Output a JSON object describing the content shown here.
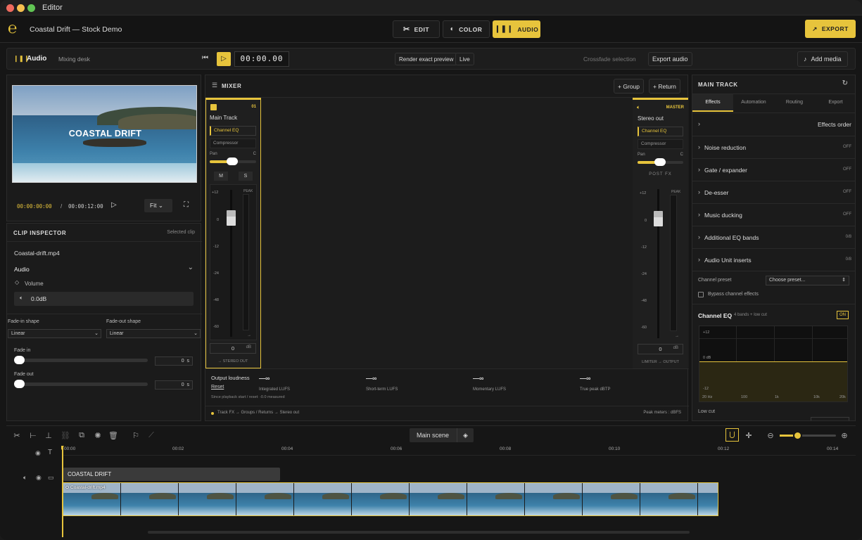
{
  "window": {
    "title": "Editor"
  },
  "app": {
    "project_title": "Coastal Drift — Stock Demo",
    "logo_icon": "e-logo-icon",
    "accent_color": "#e7c43c"
  },
  "modes": [
    {
      "label": "EDIT",
      "icon": "scissors-icon"
    },
    {
      "label": "COLOR",
      "icon": "palette-icon"
    },
    {
      "label": "AUDIO",
      "icon": "waveform-icon",
      "active": true
    }
  ],
  "export_button": "EXPORT",
  "toolbar": {
    "section": "Audio",
    "subsection": "Mixing desk",
    "timecode": "00:00.00",
    "render_preview": "Render exact preview",
    "live": "Live",
    "crossfade": "Crossfade selection",
    "export_audio": "Export audio",
    "add_media": "Add media"
  },
  "preview": {
    "overlay_title": "COASTAL DRIFT",
    "current_time": "00:00:00:00",
    "separator": "/",
    "duration": "00:00:12:00",
    "fit": "Fit"
  },
  "inspector": {
    "header": "CLIP INSPECTOR",
    "scope": "Selected clip",
    "filename": "Coastal-drift.mp4",
    "section": "Audio",
    "volume_label": "Volume",
    "volume_value": "0.0dB",
    "fade_in_shape_label": "Fade-in shape",
    "fade_in_shape": "Linear",
    "fade_out_shape_label": "Fade-out shape",
    "fade_out_shape": "Linear",
    "fade_in_label": "Fade in",
    "fade_in_value": "0",
    "fade_in_unit": "s",
    "fade_out_label": "Fade out",
    "fade_out_value": "0",
    "fade_out_unit": "s"
  },
  "mixer": {
    "header": "MIXER",
    "group_button": "+ Group",
    "return_button": "+ Return",
    "channels": [
      {
        "name": "Main Track",
        "tag": "01",
        "fx1": "Channel EQ",
        "fx2": "Compressor",
        "pan": "Pan",
        "pan_c": "C",
        "m": "M",
        "s": "S",
        "peak": "PEAK",
        "scale": [
          "+12",
          "0",
          "-12",
          "-24",
          "-48",
          "-60"
        ],
        "fader_value": "0",
        "fader_unit": "dB",
        "arrow": "→",
        "route": "→ STEREO OUT",
        "fader_level_db": 0
      },
      {
        "name": "Stereo out",
        "tag": "MASTER",
        "fx1": "Channel EQ",
        "fx2": "Compressor",
        "pan": "Pan",
        "pan_c": "C",
        "post_fx": "POST FX",
        "peak": "PEAK",
        "scale": [
          "+12",
          "0",
          "-12",
          "-24",
          "-48",
          "-60"
        ],
        "fader_value": "0",
        "fader_unit": "dB",
        "arrow": "→",
        "route": "LIMITER → OUTPUT",
        "fader_level_db": 0
      }
    ],
    "loudness": {
      "title": "Output loudness",
      "reset": "Reset",
      "note": "Since playback start / reset: -0.0 measured",
      "meters": [
        {
          "value": "—∞",
          "label": "Integrated LUFS"
        },
        {
          "value": "—∞",
          "label": "Short-term LUFS"
        },
        {
          "value": "—∞",
          "label": "Momentary LUFS"
        },
        {
          "value": "—∞",
          "label": "True peak dBTP"
        }
      ]
    },
    "footer_left": "Track FX → Groups / Returns → Stereo out",
    "footer_right": "Peak meters : dBFS"
  },
  "main_track": {
    "header": "MAIN TRACK",
    "tabs": [
      "Effects",
      "Automation",
      "Routing",
      "Export"
    ],
    "effects_order": "Effects order",
    "effects": [
      {
        "name": "Noise reduction",
        "status": "OFF"
      },
      {
        "name": "Gate / expander",
        "status": "OFF"
      },
      {
        "name": "De-esser",
        "status": "OFF"
      },
      {
        "name": "Music ducking",
        "status": "OFF"
      },
      {
        "name": "Additional EQ bands",
        "status": "0/8"
      },
      {
        "name": "Audio Unit inserts",
        "status": "0/8"
      }
    ],
    "channel_preset_label": "Channel preset",
    "channel_preset": "Choose preset...",
    "bypass": "Bypass channel effects",
    "eq_title": "Channel EQ",
    "eq_sub": "4 bands + low cut",
    "eq_on": "ON",
    "eq_y": [
      "+12",
      "0 dB",
      "-12"
    ],
    "eq_x": [
      "20 Hz",
      "100",
      "1k",
      "10k",
      "20k"
    ],
    "low_cut": "Low cut"
  },
  "timeline": {
    "scene": "Main scene",
    "ticks": [
      "00:00",
      "00:02",
      "00:04",
      "00:06",
      "00:08",
      "00:10",
      "00:12",
      "00:14"
    ],
    "title_clip": "COASTAL DRIFT",
    "video_clip": "Coastal-drift.mp4",
    "zoom_fraction": 0.3
  }
}
